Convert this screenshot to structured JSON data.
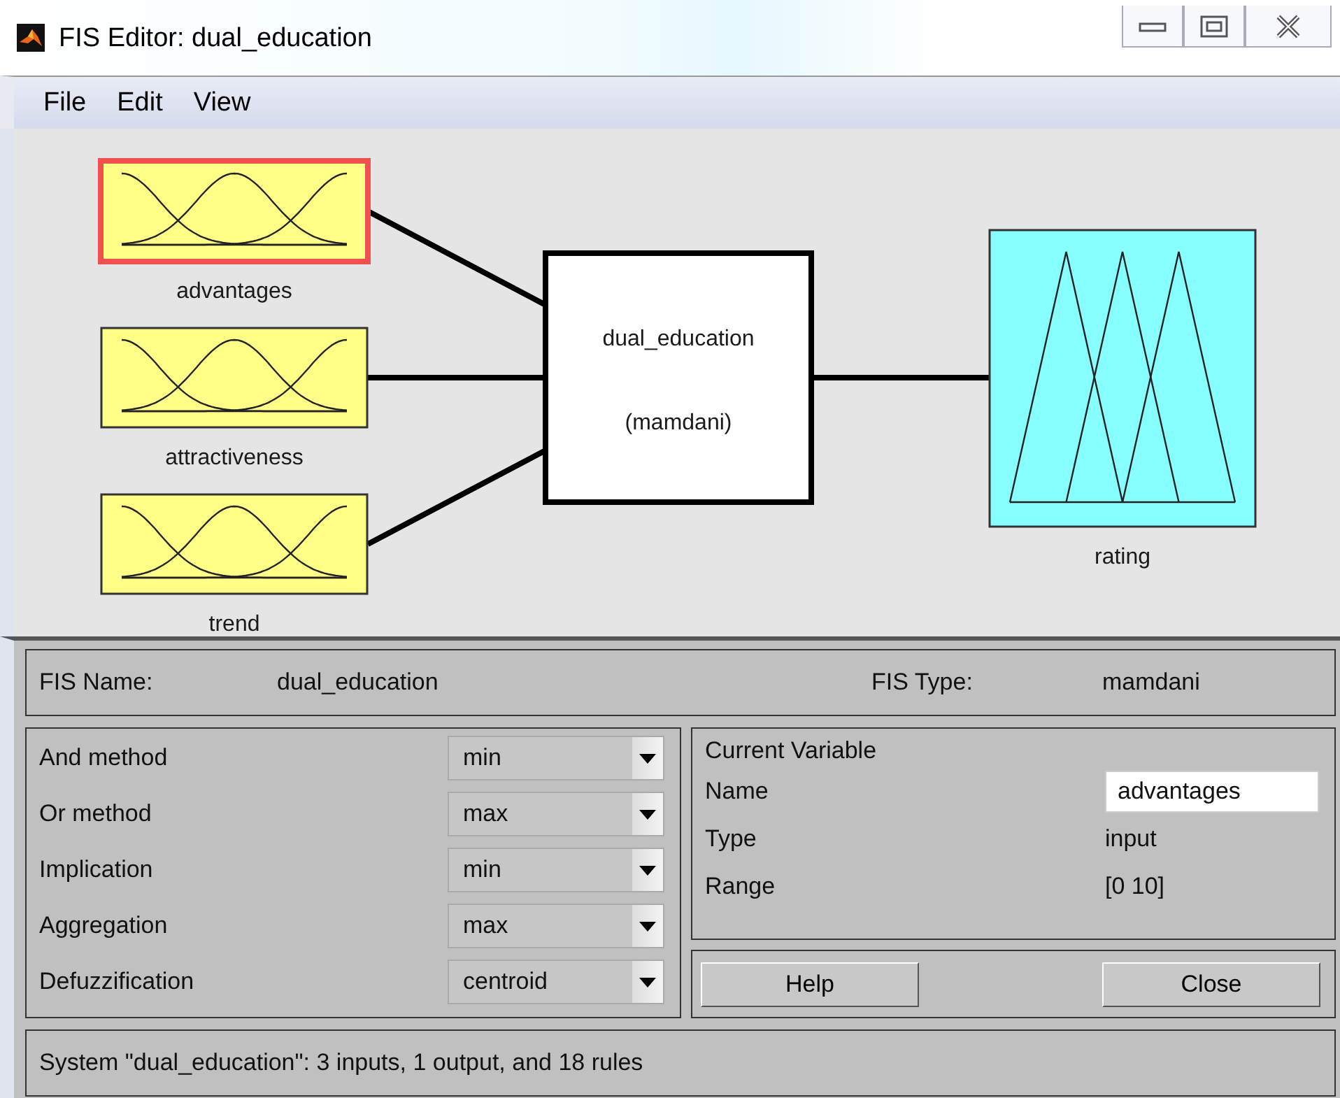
{
  "window": {
    "title": "FIS Editor: dual_education"
  },
  "menu": [
    "File",
    "Edit",
    "View"
  ],
  "diagram": {
    "inputs": [
      {
        "name": "advantages",
        "kind": "gaussian",
        "selected": true
      },
      {
        "name": "attractiveness",
        "kind": "gaussian",
        "selected": false
      },
      {
        "name": "trend",
        "kind": "gaussian",
        "selected": false
      }
    ],
    "system": {
      "name": "dual_education",
      "type": "(mamdani)"
    },
    "outputs": [
      {
        "name": "rating",
        "kind": "triangular",
        "selected": false
      }
    ]
  },
  "fis_info": {
    "name_label": "FIS Name:",
    "name": "dual_education",
    "type_label": "FIS Type:",
    "type": "mamdani"
  },
  "methods": [
    {
      "label": "And method",
      "value": "min"
    },
    {
      "label": "Or method",
      "value": "max"
    },
    {
      "label": "Implication",
      "value": "min"
    },
    {
      "label": "Aggregation",
      "value": "max"
    },
    {
      "label": "Defuzzification",
      "value": "centroid"
    }
  ],
  "current_variable": {
    "title": "Current Variable",
    "fields": [
      {
        "label": "Name",
        "value": "advantages",
        "kind": "input"
      },
      {
        "label": "Type",
        "value": "input",
        "kind": "text"
      },
      {
        "label": "Range",
        "value": "[0 10]",
        "kind": "text"
      }
    ]
  },
  "buttons": [
    "Help",
    "Close"
  ],
  "status": "System \"dual_education\": 3 inputs, 1 output, and 18 rules"
}
